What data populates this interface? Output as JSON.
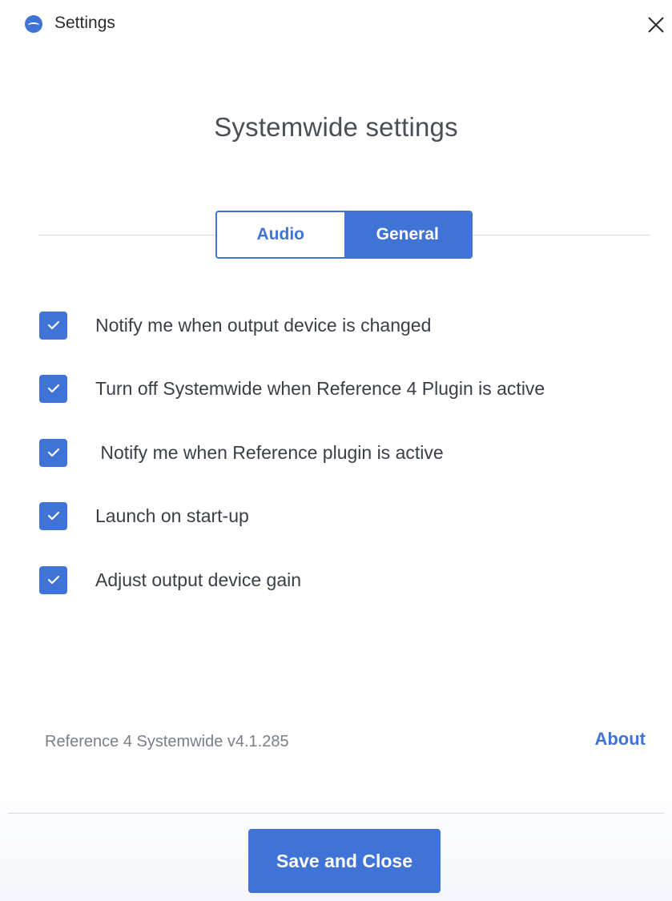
{
  "window": {
    "title": "Settings",
    "logo_icon": "systemwide-logo-icon",
    "close_icon": "close-icon"
  },
  "main": {
    "heading": "Systemwide settings",
    "tabs": [
      {
        "label": "Audio",
        "active": false
      },
      {
        "label": "General",
        "active": true
      }
    ],
    "options": [
      {
        "label": "Notify me when output device is changed",
        "checked": true
      },
      {
        "label": "Turn off Systemwide when Reference 4 Plugin is active",
        "checked": true
      },
      {
        "label": " Notify me when Reference plugin is active",
        "checked": true
      },
      {
        "label": "Launch on start-up",
        "checked": true
      },
      {
        "label": "Adjust output device gain",
        "checked": true
      }
    ]
  },
  "footer": {
    "version": "Reference 4 Systemwide v4.1.285",
    "about_label": "About",
    "save_label": "Save and Close"
  },
  "colors": {
    "accent": "#3f74d6",
    "text": "#3a3f47",
    "muted_text": "#7a7f87",
    "divider": "#d7d9dd"
  }
}
